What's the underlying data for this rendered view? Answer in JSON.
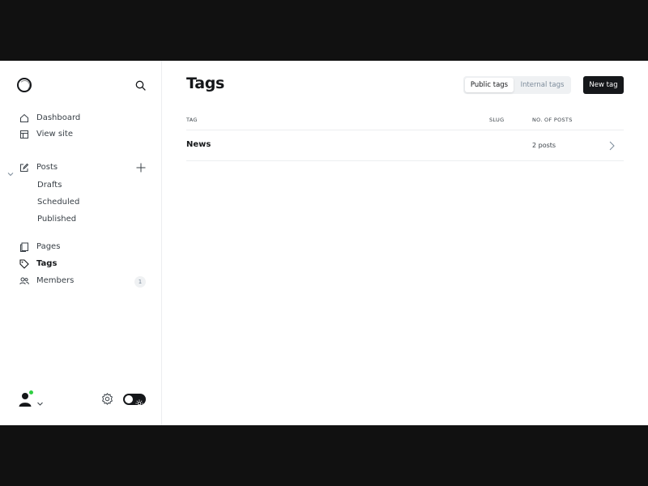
{
  "sidebar": {
    "logo_icon": "ghost-logo-icon",
    "nav": {
      "dashboard": "Dashboard",
      "view_site": "View site",
      "posts": "Posts",
      "pages": "Pages",
      "tags": "Tags",
      "members": "Members"
    },
    "posts_sub": {
      "drafts": "Drafts",
      "scheduled": "Scheduled",
      "published": "Published"
    },
    "members_count": "1",
    "status_color": "#30cf43"
  },
  "header": {
    "title": "Tags",
    "tabs": {
      "public": "Public tags",
      "internal": "Internal tags",
      "selected": "Public tags"
    },
    "new_tag_label": "New tag"
  },
  "table": {
    "columns": {
      "tag": "TAG",
      "slug": "SLUG",
      "posts": "NO. OF POSTS"
    },
    "rows": [
      {
        "name": "News",
        "slug": "",
        "posts": "2 posts"
      }
    ]
  },
  "colors": {
    "accent": "#15171a",
    "muted": "#7c8b9a"
  }
}
